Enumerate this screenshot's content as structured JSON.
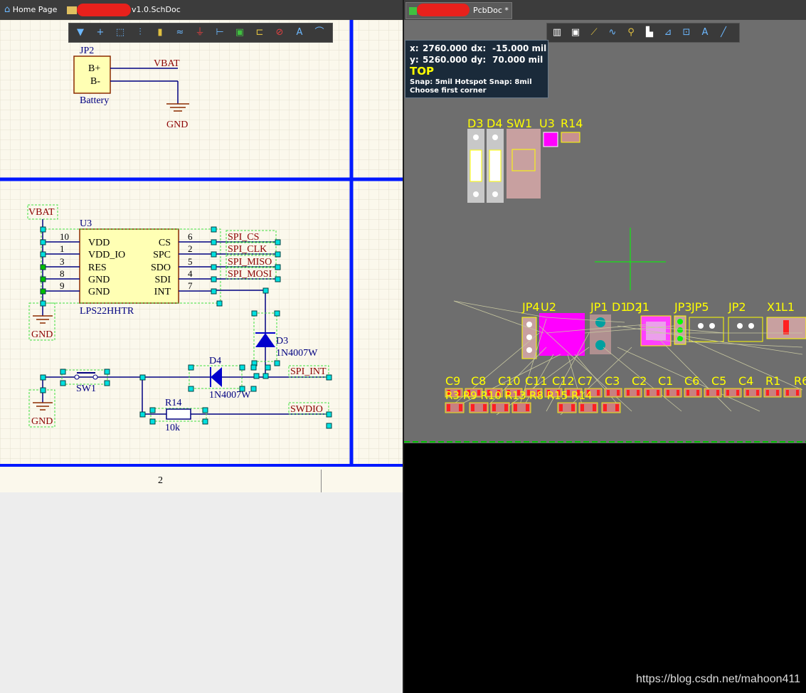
{
  "left_tab": {
    "home_label": "Home Page",
    "doc_suffix": "v1.0.SchDoc"
  },
  "right_tab": {
    "doc_suffix": "PcbDoc *"
  },
  "schematic": {
    "battery": {
      "ref": "JP2",
      "pin1": "B+",
      "pin2": "B-",
      "value": "Battery"
    },
    "nets": {
      "vbat_top": "VBAT",
      "gnd_top": "GND",
      "vbat_u3": "VBAT",
      "gnd_u3": "GND",
      "gnd_sw": "GND"
    },
    "u3": {
      "ref": "U3",
      "value": "LPS22HHTR",
      "left_pins": [
        {
          "num": "10",
          "name": "VDD"
        },
        {
          "num": "1",
          "name": "VDD_IO"
        },
        {
          "num": "3",
          "name": "RES"
        },
        {
          "num": "8",
          "name": "GND"
        },
        {
          "num": "9",
          "name": "GND"
        }
      ],
      "right_pins": [
        {
          "num": "6",
          "name": "CS",
          "net": "SPI_CS"
        },
        {
          "num": "2",
          "name": "SPC",
          "net": "SPI_CLK"
        },
        {
          "num": "5",
          "name": "SDO",
          "net": "SPI_MISO"
        },
        {
          "num": "4",
          "name": "SDI",
          "net": "SPI_MOSI"
        },
        {
          "num": "7",
          "name": "INT",
          "net": ""
        }
      ]
    },
    "d3": {
      "ref": "D3",
      "value": "1N4007W"
    },
    "d4": {
      "ref": "D4",
      "value": "1N4007W"
    },
    "sw1": {
      "ref": "SW1"
    },
    "r14": {
      "ref": "R14",
      "value": "10k"
    },
    "net_spi_int": "SPI_INT",
    "net_swdio": "SWDIO",
    "sheet_zone": "2"
  },
  "pcb": {
    "hud": {
      "x_label": "x:",
      "x_value": "2760.000",
      "dx_label": "dx:",
      "dx_value": "-15.000 mil",
      "y_label": "y:",
      "y_value": "5260.000",
      "dy_label": "dy:",
      "dy_value": "70.000 mil",
      "layer": "TOP",
      "snap": "Snap: 5mil Hotspot Snap: 8mil",
      "status": "Choose first corner"
    },
    "top_labels": [
      "D3",
      "D4",
      "SW1",
      "U3",
      "R14"
    ],
    "mid_labels": [
      "JP4",
      "U2",
      "JP1",
      "D1",
      "D2",
      "J1",
      "JP3",
      "JP5",
      "JP2",
      "X1",
      "L1"
    ],
    "row_labels": [
      "C9",
      "C8",
      "C10",
      "C11",
      "C12",
      "C7",
      "C3",
      "C2",
      "C1",
      "C6",
      "C5",
      "C4",
      "R1",
      "R6"
    ],
    "bottom_labels": "R3 R9 R10 R13 R8 R15 R14",
    "colors": {
      "silkscreen": "#ffff00",
      "top_layer": "#ff2020",
      "board": "#6e6e6e",
      "ratsnest": "#c8c8a0",
      "highlight": "#ff00ff"
    }
  },
  "watermark": "https://blog.csdn.net/mahoon411"
}
